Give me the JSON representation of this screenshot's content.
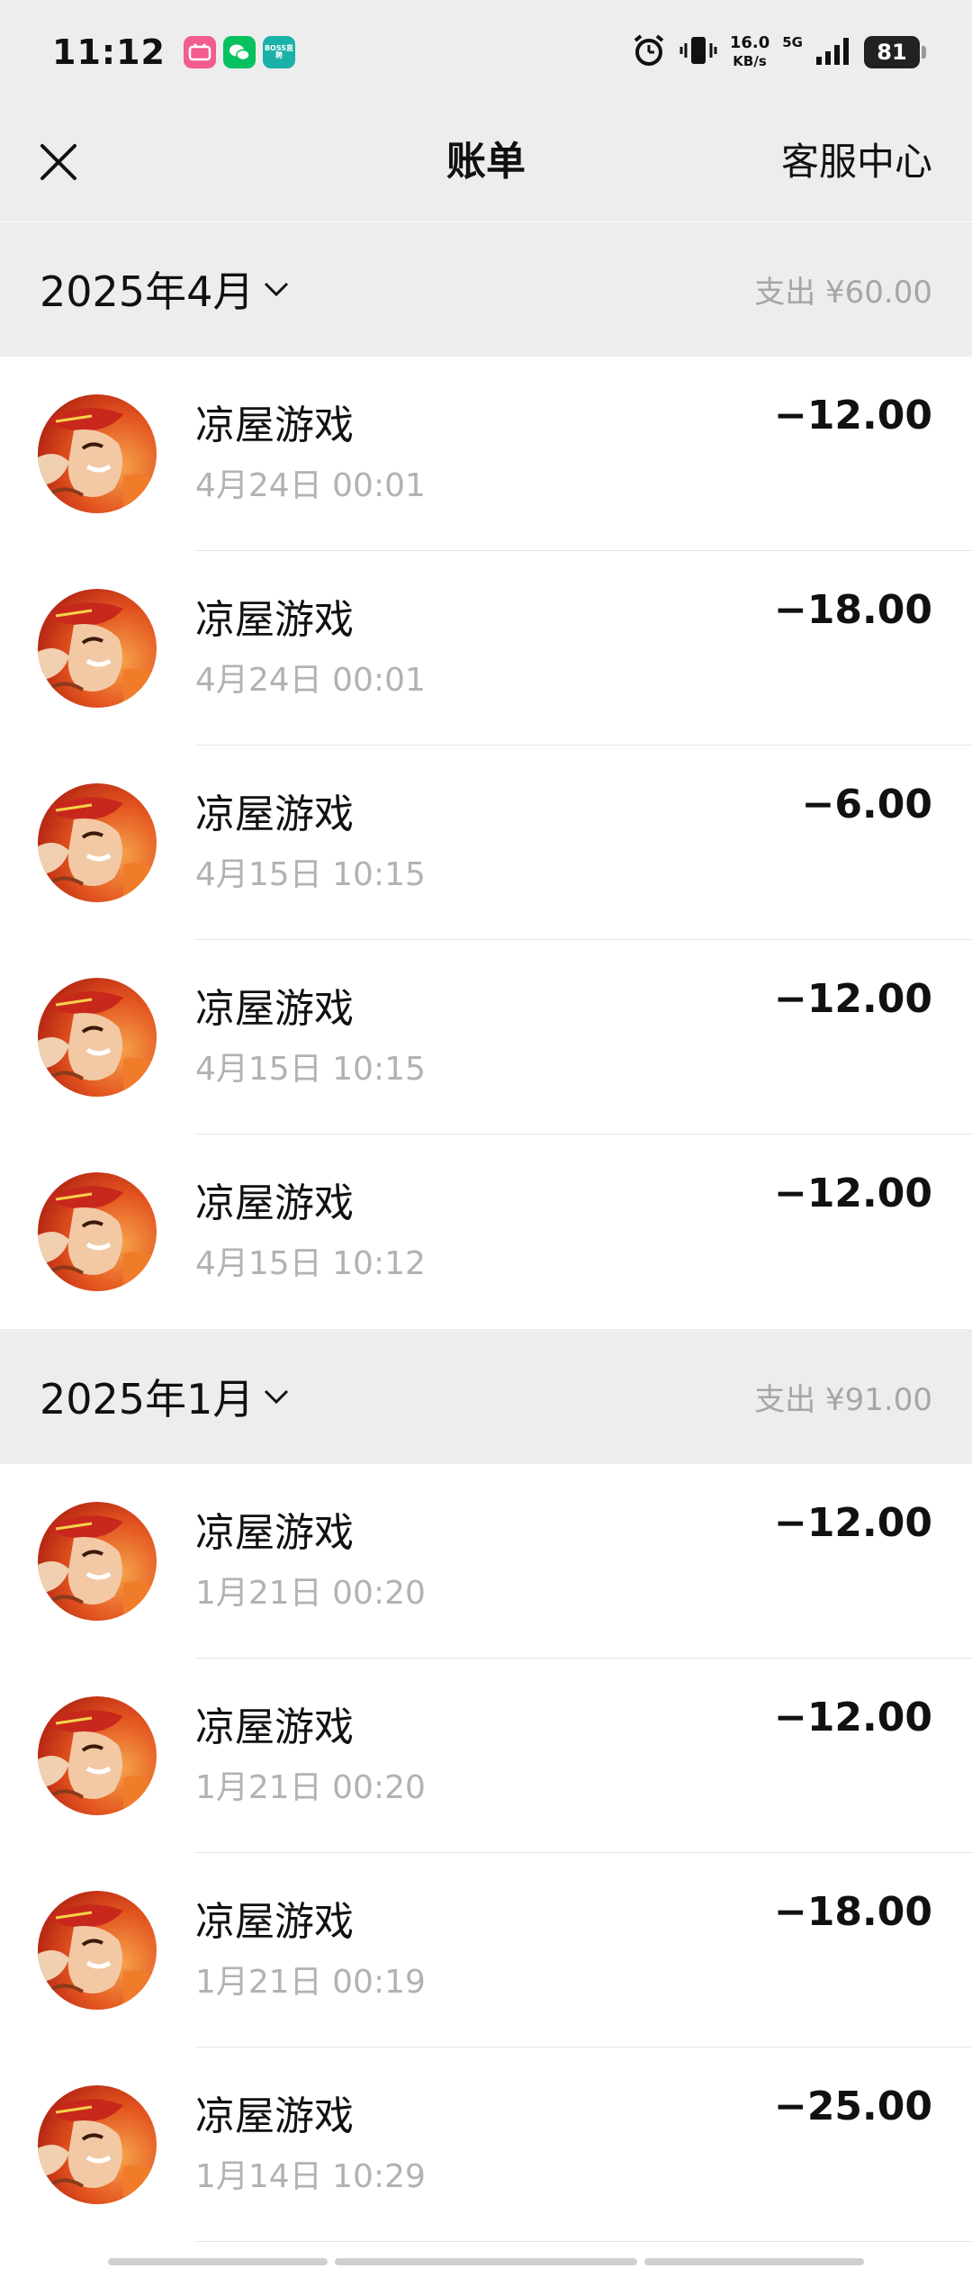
{
  "status": {
    "time": "11:12",
    "net_speed_value": "16.0",
    "net_speed_unit": "KB/s",
    "network": "5G",
    "battery": "81",
    "badges": [
      {
        "name": "bilibili-app-icon",
        "text": "bili",
        "color": "#f25d8e"
      },
      {
        "name": "wechat-app-icon",
        "text": "",
        "color": "#07c160"
      },
      {
        "name": "boss-app-icon",
        "text": "BOSS直聘",
        "color": "#19b1a8"
      }
    ]
  },
  "nav": {
    "title": "账单",
    "service": "客服中心"
  },
  "months": [
    {
      "label": "2025年4月",
      "total": "支出 ¥60.00",
      "transactions": [
        {
          "name": "凉屋游戏",
          "time": "4月24日 00:01",
          "amount": "−12.00"
        },
        {
          "name": "凉屋游戏",
          "time": "4月24日 00:01",
          "amount": "−18.00"
        },
        {
          "name": "凉屋游戏",
          "time": "4月15日 10:15",
          "amount": "−6.00"
        },
        {
          "name": "凉屋游戏",
          "time": "4月15日 10:15",
          "amount": "−12.00"
        },
        {
          "name": "凉屋游戏",
          "time": "4月15日 10:12",
          "amount": "−12.00"
        }
      ]
    },
    {
      "label": "2025年1月",
      "total": "支出 ¥91.00",
      "transactions": [
        {
          "name": "凉屋游戏",
          "time": "1月21日 00:20",
          "amount": "−12.00"
        },
        {
          "name": "凉屋游戏",
          "time": "1月21日 00:20",
          "amount": "−12.00"
        },
        {
          "name": "凉屋游戏",
          "time": "1月21日 00:19",
          "amount": "−18.00"
        },
        {
          "name": "凉屋游戏",
          "time": "1月14日 10:29",
          "amount": "−25.00"
        }
      ]
    }
  ]
}
